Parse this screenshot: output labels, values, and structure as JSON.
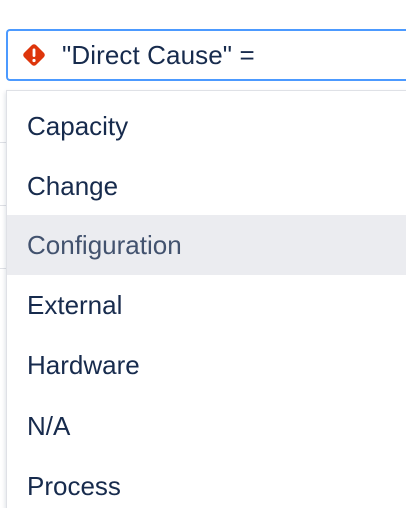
{
  "query": {
    "text": "\"Direct Cause\" =",
    "status_icon": "error-icon",
    "error_color": "#de350b",
    "focus_color": "#4c9aff"
  },
  "dropdown": {
    "options": [
      {
        "label": "Capacity",
        "highlighted": false
      },
      {
        "label": "Change",
        "highlighted": false
      },
      {
        "label": "Configuration",
        "highlighted": true
      },
      {
        "label": "External",
        "highlighted": false
      },
      {
        "label": "Hardware",
        "highlighted": false
      },
      {
        "label": "N/A",
        "highlighted": false
      },
      {
        "label": "Process",
        "highlighted": false
      }
    ],
    "highlight_color": "#ebecf0"
  }
}
